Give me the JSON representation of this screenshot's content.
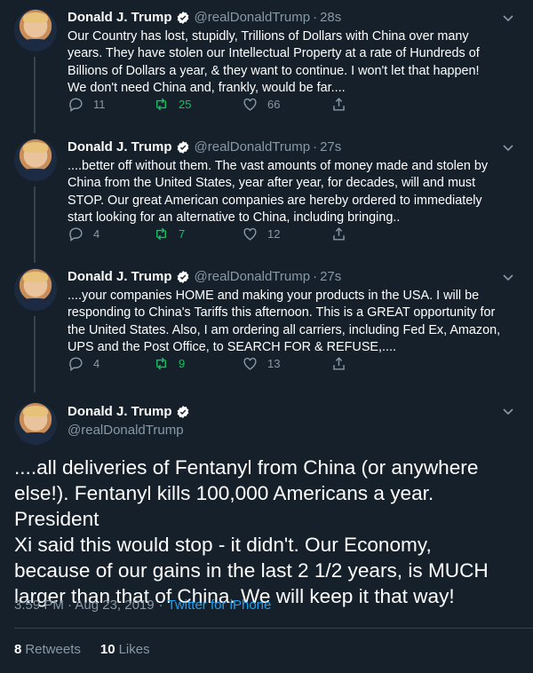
{
  "colors": {
    "background": "#15202b",
    "text": "#ffffff",
    "muted": "#8899a6",
    "retweet": "#17bf63",
    "link": "#1da1f2",
    "verified": "#ffffff"
  },
  "thread": [
    {
      "name": "Donald J. Trump",
      "handle": "@realDonaldTrump",
      "separator": "·",
      "time": "28s",
      "text": "Our Country has lost, stupidly, Trillions of Dollars with China over many\nyears. They have stolen our Intellectual Property at a rate of Hundreds of\nBillions of Dollars a year, & they want to continue. I won't let that happen!\nWe don't need China and, frankly, would be far....",
      "replies": "11",
      "retweets": "25",
      "likes": "66"
    },
    {
      "name": "Donald J. Trump",
      "handle": "@realDonaldTrump",
      "separator": "·",
      "time": "27s",
      "text": "....better off without them. The vast amounts of money made and stolen by\nChina from the United States, year after year, for decades, will and must\nSTOP. Our great American companies are hereby ordered to immediately\nstart looking for an alternative to China, including bringing..",
      "replies": "4",
      "retweets": "7",
      "likes": "12"
    },
    {
      "name": "Donald J. Trump",
      "handle": "@realDonaldTrump",
      "separator": "·",
      "time": "27s",
      "text": "....your companies HOME and making your products in the USA. I will be\nresponding to China's Tariffs this afternoon. This is a GREAT opportunity for\nthe United States. Also, I am ordering all carriers, including Fed Ex, Amazon,\nUPS and the Post Office, to SEARCH FOR & REFUSE,....",
      "replies": "4",
      "retweets": "9",
      "likes": "13"
    }
  ],
  "main_tweet": {
    "name": "Donald J. Trump",
    "handle": "@realDonaldTrump",
    "text": "....all deliveries of Fentanyl from China (or anywhere\nelse!). Fentanyl kills 100,000 Americans a year. President\nXi said this would stop - it didn't. Our Economy,\nbecause of our gains in the last 2 1/2 years, is MUCH\nlarger than that of China. We will keep it that way!",
    "time": "3:59 PM · Aug 23, 2019",
    "separator": "·",
    "source": "Twitter for iPhone",
    "retweets_count": "8",
    "retweets_label": "Retweets",
    "likes_count": "10",
    "likes_label": "Likes"
  },
  "icons": [
    "verified-badge-icon",
    "chevron-down-icon",
    "reply-icon",
    "retweet-icon",
    "like-icon",
    "share-icon"
  ]
}
